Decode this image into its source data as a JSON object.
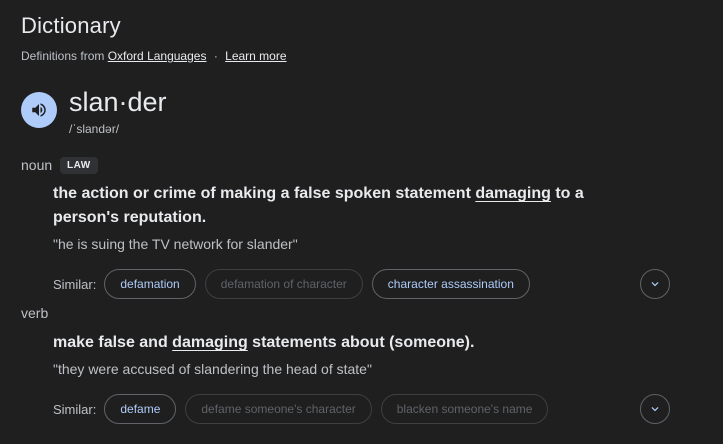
{
  "header": {
    "title": "Dictionary",
    "source_prefix": "Definitions from",
    "source_link": "Oxford Languages",
    "separator": "·",
    "learn_more": "Learn more"
  },
  "entry": {
    "word": "slan·der",
    "phonetic": "/ˈslandər/",
    "speaker_icon": "speaker-icon"
  },
  "senses": [
    {
      "pos": "noun",
      "label": "LAW",
      "definition_before": "the action or crime of making a false spoken statement ",
      "definition_link": "damaging",
      "definition_after": " to a person's reputation.",
      "example": "\"he is suing the TV network for slander\"",
      "similar_label": "Similar:",
      "similar": [
        "defamation",
        "defamation of character",
        "character assassination"
      ],
      "similar_active": [
        true,
        false,
        true
      ]
    },
    {
      "pos": "verb",
      "definition_before": "make false and ",
      "definition_link": "damaging",
      "definition_after": " statements about (someone).",
      "example": "\"they were accused of slandering the head of state\"",
      "similar_label": "Similar:",
      "similar": [
        "defame",
        "defame someone's character",
        "blacken someone's name"
      ],
      "similar_active": [
        true,
        false,
        false
      ]
    }
  ],
  "colors": {
    "background": "#1f1f1f",
    "accent": "#aecbfa",
    "muted": "#5f6368"
  }
}
